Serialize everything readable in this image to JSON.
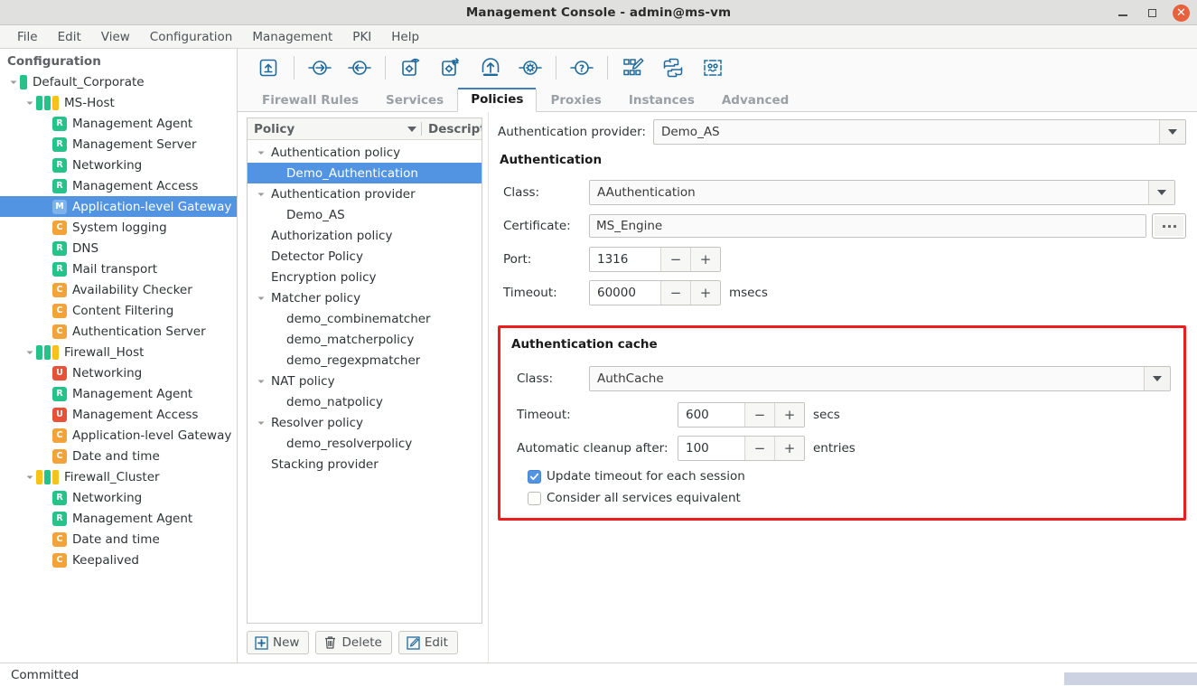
{
  "window": {
    "title": "Management Console - admin@ms-vm",
    "minimize_icon": "minimize-icon",
    "maximize_icon": "maximize-icon",
    "close_icon": "close-icon",
    "close_color": "#e8603c"
  },
  "menubar": {
    "items": [
      "File",
      "Edit",
      "View",
      "Configuration",
      "Management",
      "PKI",
      "Help"
    ]
  },
  "sidebar": {
    "header": "Configuration",
    "items": [
      {
        "label": "Default_Corporate",
        "depth": 0,
        "arrow": "down",
        "icon": "status-bar-green",
        "bars": [
          "g"
        ]
      },
      {
        "label": "MS-Host",
        "depth": 1,
        "arrow": "down",
        "icon": "status-bars",
        "bars": [
          "g",
          "g",
          "y"
        ]
      },
      {
        "label": "Management Agent",
        "depth": 2,
        "arrow": "none",
        "icon": "badge",
        "badge": "R"
      },
      {
        "label": "Management Server",
        "depth": 2,
        "arrow": "none",
        "icon": "badge",
        "badge": "R"
      },
      {
        "label": "Networking",
        "depth": 2,
        "arrow": "none",
        "icon": "badge",
        "badge": "R"
      },
      {
        "label": "Management Access",
        "depth": 2,
        "arrow": "none",
        "icon": "badge",
        "badge": "R"
      },
      {
        "label": "Application-level Gateway",
        "depth": 2,
        "arrow": "none",
        "icon": "badge",
        "badge": "M",
        "selected": true
      },
      {
        "label": "System logging",
        "depth": 2,
        "arrow": "none",
        "icon": "badge",
        "badge": "C"
      },
      {
        "label": "DNS",
        "depth": 2,
        "arrow": "none",
        "icon": "badge",
        "badge": "R"
      },
      {
        "label": "Mail transport",
        "depth": 2,
        "arrow": "none",
        "icon": "badge",
        "badge": "R"
      },
      {
        "label": "Availability Checker",
        "depth": 2,
        "arrow": "none",
        "icon": "badge",
        "badge": "C"
      },
      {
        "label": "Content Filtering",
        "depth": 2,
        "arrow": "none",
        "icon": "badge",
        "badge": "C"
      },
      {
        "label": "Authentication Server",
        "depth": 2,
        "arrow": "none",
        "icon": "badge",
        "badge": "C"
      },
      {
        "label": "Firewall_Host",
        "depth": 1,
        "arrow": "down",
        "icon": "status-bars",
        "bars": [
          "g",
          "g",
          "y"
        ]
      },
      {
        "label": "Networking",
        "depth": 2,
        "arrow": "none",
        "icon": "badge",
        "badge": "U"
      },
      {
        "label": "Management Agent",
        "depth": 2,
        "arrow": "none",
        "icon": "badge",
        "badge": "R"
      },
      {
        "label": "Management Access",
        "depth": 2,
        "arrow": "none",
        "icon": "badge",
        "badge": "U"
      },
      {
        "label": "Application-level Gateway",
        "depth": 2,
        "arrow": "none",
        "icon": "badge",
        "badge": "C"
      },
      {
        "label": "Date and time",
        "depth": 2,
        "arrow": "none",
        "icon": "badge",
        "badge": "C"
      },
      {
        "label": "Firewall_Cluster",
        "depth": 1,
        "arrow": "down",
        "icon": "status-bars",
        "bars": [
          "y",
          "g",
          "y"
        ]
      },
      {
        "label": "Networking",
        "depth": 2,
        "arrow": "none",
        "icon": "badge",
        "badge": "R"
      },
      {
        "label": "Management Agent",
        "depth": 2,
        "arrow": "none",
        "icon": "badge",
        "badge": "R"
      },
      {
        "label": "Date and time",
        "depth": 2,
        "arrow": "none",
        "icon": "badge",
        "badge": "C"
      },
      {
        "label": "Keepalived",
        "depth": 2,
        "arrow": "none",
        "icon": "badge",
        "badge": "C"
      }
    ]
  },
  "toolbar": {
    "buttons": [
      {
        "name": "go-up-icon",
        "group": 0
      },
      {
        "name": "forward-arrow-icon",
        "group": 1
      },
      {
        "name": "back-arrow-icon",
        "group": 1
      },
      {
        "name": "view-config-icon",
        "group": 2
      },
      {
        "name": "transfer-config-icon",
        "group": 2
      },
      {
        "name": "upload-icon",
        "group": 2
      },
      {
        "name": "settings-icon",
        "group": 2
      },
      {
        "name": "help-icon",
        "group": 3
      },
      {
        "name": "edit-matrix-icon",
        "group": 4
      },
      {
        "name": "python-icon",
        "group": 4
      },
      {
        "name": "debug-icon",
        "group": 4
      }
    ]
  },
  "tabs": {
    "items": [
      "Firewall Rules",
      "Services",
      "Policies",
      "Proxies",
      "Instances",
      "Advanced"
    ],
    "active": "Policies"
  },
  "policy_panel": {
    "columns": [
      "Policy",
      "Descript"
    ],
    "rows": [
      {
        "label": "Authentication policy",
        "depth": 0,
        "arrow": "down"
      },
      {
        "label": "Demo_Authentication",
        "depth": 1,
        "arrow": "none",
        "selected": true
      },
      {
        "label": "Authentication provider",
        "depth": 0,
        "arrow": "down"
      },
      {
        "label": "Demo_AS",
        "depth": 1,
        "arrow": "none"
      },
      {
        "label": "Authorization policy",
        "depth": 0,
        "arrow": "none"
      },
      {
        "label": "Detector Policy",
        "depth": 0,
        "arrow": "none"
      },
      {
        "label": "Encryption policy",
        "depth": 0,
        "arrow": "none"
      },
      {
        "label": "Matcher policy",
        "depth": 0,
        "arrow": "down"
      },
      {
        "label": "demo_combinematcher",
        "depth": 1,
        "arrow": "none"
      },
      {
        "label": "demo_matcherpolicy",
        "depth": 1,
        "arrow": "none"
      },
      {
        "label": "demo_regexpmatcher",
        "depth": 1,
        "arrow": "none"
      },
      {
        "label": "NAT policy",
        "depth": 0,
        "arrow": "down"
      },
      {
        "label": "demo_natpolicy",
        "depth": 1,
        "arrow": "none"
      },
      {
        "label": "Resolver policy",
        "depth": 0,
        "arrow": "down"
      },
      {
        "label": "demo_resolverpolicy",
        "depth": 1,
        "arrow": "none"
      },
      {
        "label": "Stacking provider",
        "depth": 0,
        "arrow": "none"
      }
    ],
    "buttons": [
      {
        "label": "New",
        "icon": "plus-icon"
      },
      {
        "label": "Delete",
        "icon": "trash-icon"
      },
      {
        "label": "Edit",
        "icon": "pencil-icon"
      }
    ]
  },
  "form": {
    "provider_label": "Authentication provider:",
    "provider_value": "Demo_AS",
    "auth_group_title": "Authentication",
    "class_label": "Class:",
    "class_value": "AAuthentication",
    "certificate_label": "Certificate:",
    "certificate_value": "MS_Engine",
    "browse_label": "...",
    "port_label": "Port:",
    "port_value": "1316",
    "timeout_label": "Timeout:",
    "timeout_value": "60000",
    "timeout_unit": "msecs",
    "minus": "−",
    "plus": "+"
  },
  "cache": {
    "border_color": "#ee1c1c",
    "title": "Authentication cache",
    "class_label": "Class:",
    "class_value": "AuthCache",
    "timeout_label": "Timeout:",
    "timeout_value": "600",
    "timeout_unit": "secs",
    "cleanup_label": "Automatic cleanup after:",
    "cleanup_value": "100",
    "cleanup_unit": "entries",
    "checkbox_update": "Update timeout for each session",
    "checkbox_update_checked": true,
    "checkbox_equivalent": "Consider all services equivalent",
    "checkbox_equivalent_checked": false,
    "minus": "−",
    "plus": "+"
  },
  "statusbar": {
    "text": "Committed"
  }
}
